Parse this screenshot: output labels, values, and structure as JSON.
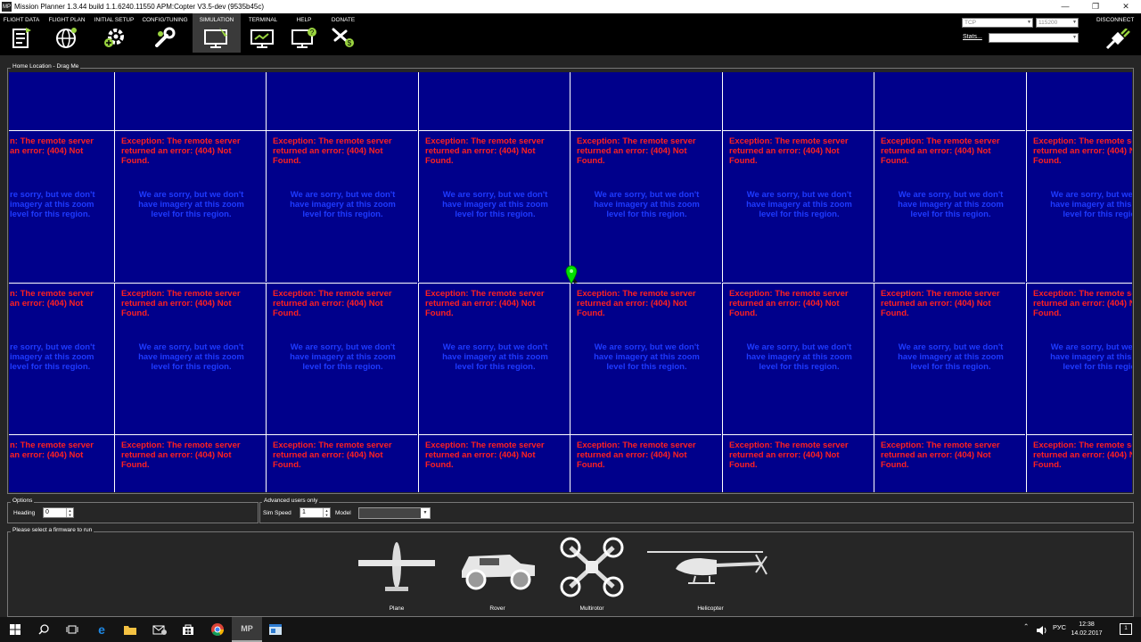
{
  "window": {
    "title": "Mission Planner 1.3.44 build 1.1.6240.11550 APM:Copter V3.5-dev (9535b45c)",
    "app_icon_text": "MP",
    "minimize": "—",
    "maximize": "❐",
    "close": "✕"
  },
  "menu": [
    {
      "label": "FLIGHT DATA",
      "icon": "flight-data-icon"
    },
    {
      "label": "FLIGHT PLAN",
      "icon": "globe-icon"
    },
    {
      "label": "INITIAL SETUP",
      "icon": "setup-gear-icon"
    },
    {
      "label": "CONFIG/TUNING",
      "icon": "wrench-icon"
    },
    {
      "label": "SIMULATION",
      "icon": "simulation-monitor-icon"
    },
    {
      "label": "TERMINAL",
      "icon": "terminal-monitor-icon"
    },
    {
      "label": "HELP",
      "icon": "help-monitor-icon"
    },
    {
      "label": "DONATE",
      "icon": "donate-plane-icon"
    }
  ],
  "connection": {
    "port": "TCP",
    "baud": "115200",
    "stats_label": "Stats...",
    "disconnect_label": "DISCONNECT"
  },
  "map": {
    "group_label": "Home Location - Drag Me",
    "error_text": "Exception: The remote server returned an error: (404) Not Found.",
    "no_imagery_text": "We are sorry, but we don't have imagery at this zoom level for this region.",
    "tile_fragment_error": "n: The remote server\nan error: (404) Not",
    "tile_fragment_error_right": "Exception: The remote server returned an error: (404) Not Found.",
    "tile_fragment_sorry": "re sorry, but we don't\nimagery at this zoom\nlevel for this region.",
    "accent_bg": "#00008b",
    "error_color": "#ff2020",
    "sorry_color": "#1e3aff"
  },
  "options": {
    "group_label": "Options",
    "heading_label": "Heading",
    "heading_value": "0"
  },
  "advanced": {
    "group_label": "Advanced users only",
    "simspeed_label": "Sim Speed",
    "simspeed_value": "1",
    "model_label": "Model",
    "model_value": ""
  },
  "firmware": {
    "group_label": "Please select a firmware to run",
    "items": [
      {
        "label": "Plane",
        "icon": "plane-icon"
      },
      {
        "label": "Rover",
        "icon": "rover-icon"
      },
      {
        "label": "Multirotor",
        "icon": "multirotor-icon"
      },
      {
        "label": "Helicopter",
        "icon": "helicopter-icon"
      }
    ]
  },
  "taskbar": {
    "language": "РУС",
    "time": "12:38",
    "date": "14.02.2017",
    "notification_count": "1",
    "mp_label": "MP"
  }
}
